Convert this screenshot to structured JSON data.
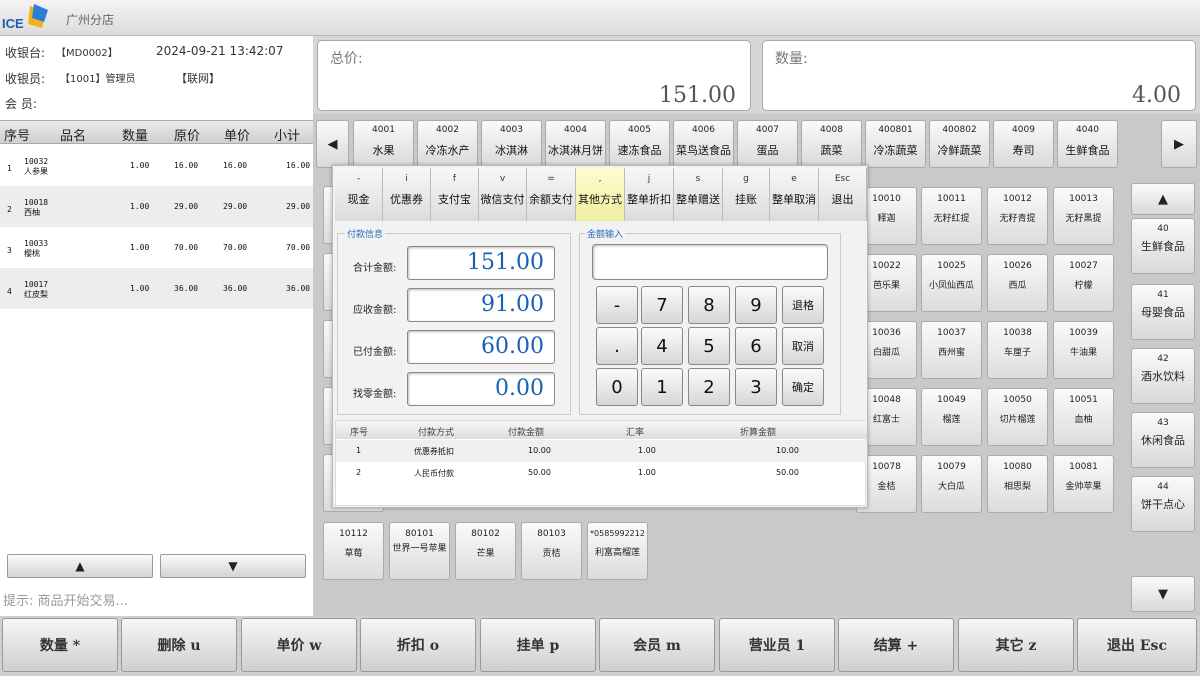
{
  "app": {
    "logo_text": "ICE",
    "branch": "广州分店"
  },
  "cashier": {
    "register_label": "收银台:",
    "register_value": "【MD0002】",
    "datetime": "2024-09-21 13:42:07",
    "operator_label": "收银员:",
    "operator_value": "【1001】管理员",
    "network": "【联网】",
    "member_label": "会  员:"
  },
  "item_table": {
    "headers": [
      "序号",
      "品名",
      "数量",
      "原价",
      "单价",
      "小计"
    ],
    "rows": [
      {
        "no": "1",
        "code": "10032",
        "name": "人参果",
        "qty": "1.00",
        "orig": "16.00",
        "price": "16.00",
        "sub": "16.00"
      },
      {
        "no": "2",
        "code": "10018",
        "name": "西柚",
        "qty": "1.00",
        "orig": "29.00",
        "price": "29.00",
        "sub": "29.00"
      },
      {
        "no": "3",
        "code": "10033",
        "name": "樱桃",
        "qty": "1.00",
        "orig": "70.00",
        "price": "70.00",
        "sub": "70.00"
      },
      {
        "no": "4",
        "code": "10017",
        "name": "红皮梨",
        "qty": "1.00",
        "orig": "36.00",
        "price": "36.00",
        "sub": "36.00"
      }
    ]
  },
  "scroll": {
    "up": "▲",
    "down": "▼"
  },
  "hint": "提示: 商品开始交易...",
  "totals": {
    "total_label": "总价:",
    "total_value": "151.00",
    "qty_label": "数量:",
    "qty_value": "4.00"
  },
  "categories": [
    {
      "code": "4001",
      "name": "水果"
    },
    {
      "code": "4002",
      "name": "冷冻水产"
    },
    {
      "code": "4003",
      "name": "冰淇淋"
    },
    {
      "code": "4004",
      "name": "冰淇淋月饼"
    },
    {
      "code": "4005",
      "name": "速冻食品"
    },
    {
      "code": "4006",
      "name": "菜鸟送食品"
    },
    {
      "code": "4007",
      "name": "蛋品"
    },
    {
      "code": "4008",
      "name": "蔬菜"
    },
    {
      "code": "400801",
      "name": "冷冻蔬菜"
    },
    {
      "code": "400802",
      "name": "冷鲜蔬菜"
    },
    {
      "code": "4009",
      "name": "寿司"
    },
    {
      "code": "4040",
      "name": "生鲜食品"
    }
  ],
  "nav": {
    "prev": "◀",
    "next": "▶",
    "up": "▲",
    "down": "▼"
  },
  "side_categories": [
    {
      "code": "40",
      "name": "生鲜食品"
    },
    {
      "code": "41",
      "name": "母婴食品"
    },
    {
      "code": "42",
      "name": "酒水饮料"
    },
    {
      "code": "43",
      "name": "休闲食品"
    },
    {
      "code": "44",
      "name": "饼干点心"
    }
  ],
  "products_right": [
    [
      {
        "code": "10010",
        "name": "释迦"
      },
      {
        "code": "10011",
        "name": "无籽红提"
      },
      {
        "code": "10012",
        "name": "无籽青提"
      },
      {
        "code": "10013",
        "name": "无籽黑提"
      }
    ],
    [
      {
        "code": "10022",
        "name": "芭乐果"
      },
      {
        "code": "10025",
        "name": "小凤仙西瓜"
      },
      {
        "code": "10026",
        "name": "西瓜"
      },
      {
        "code": "10027",
        "name": "柠檬"
      }
    ],
    [
      {
        "code": "10036",
        "name": "白甜瓜"
      },
      {
        "code": "10037",
        "name": "西州蜜"
      },
      {
        "code": "10038",
        "name": "车厘子"
      },
      {
        "code": "10039",
        "name": "牛油果"
      }
    ],
    [
      {
        "code": "10048",
        "name": "红富士"
      },
      {
        "code": "10049",
        "name": "榴莲"
      },
      {
        "code": "10050",
        "name": "切片榴莲"
      },
      {
        "code": "10051",
        "name": "血柚"
      }
    ],
    [
      {
        "code": "10078",
        "name": "金桔"
      },
      {
        "code": "10079",
        "name": "大白瓜"
      },
      {
        "code": "10080",
        "name": "相思梨"
      },
      {
        "code": "10081",
        "name": "金帅苹果"
      }
    ]
  ],
  "products_bottom": [
    {
      "code": "10112",
      "name": "草莓"
    },
    {
      "code": "80101",
      "name": "世界一号苹果"
    },
    {
      "code": "80102",
      "name": "芒果"
    },
    {
      "code": "80103",
      "name": "贡桔"
    },
    {
      "code": "*0585992212",
      "name": "利富高榴莲"
    }
  ],
  "dialog": {
    "pay_methods": [
      {
        "key": "-",
        "label": "现金"
      },
      {
        "key": "i",
        "label": "优惠券"
      },
      {
        "key": "f",
        "label": "支付宝"
      },
      {
        "key": "v",
        "label": "微信支付"
      },
      {
        "key": "=",
        "label": "余额支付"
      },
      {
        "key": ",",
        "label": "其他方式"
      },
      {
        "key": "j",
        "label": "整单折扣"
      },
      {
        "key": "s",
        "label": "整单赠送"
      },
      {
        "key": "g",
        "label": "挂账"
      },
      {
        "key": "e",
        "label": "整单取消"
      },
      {
        "key": "Esc",
        "label": "退出"
      }
    ],
    "payinfo_title": "付款信息",
    "amounts": [
      {
        "label": "合计金额:",
        "value": "151.00"
      },
      {
        "label": "应收金额:",
        "value": "91.00"
      },
      {
        "label": "已付金额:",
        "value": "60.00"
      },
      {
        "label": "找零金额:",
        "value": "0.00"
      }
    ],
    "input_title": "金额输入",
    "input_value": "",
    "keys": {
      "minus": "-",
      "k7": "7",
      "k8": "8",
      "k9": "9",
      "back": "退格",
      "dot": ".",
      "k4": "4",
      "k5": "5",
      "k6": "6",
      "cancel": "取消",
      "k0": "0",
      "k1": "1",
      "k2": "2",
      "k3": "3",
      "ok": "确定"
    },
    "pay_table": {
      "headers": [
        "序号",
        "付款方式",
        "付款金额",
        "汇率",
        "折算金额"
      ],
      "rows": [
        {
          "no": "1",
          "method": "优惠券抵扣",
          "amount": "10.00",
          "rate": "1.00",
          "converted": "10.00"
        },
        {
          "no": "2",
          "method": "人民币付款",
          "amount": "50.00",
          "rate": "1.00",
          "converted": "50.00"
        }
      ]
    }
  },
  "function_keys": [
    "数量 *",
    "删除 u",
    "单价 w",
    "折扣 o",
    "挂单 p",
    "会员 m",
    "营业员 1",
    "结算 +",
    "其它 z",
    "退出 Esc"
  ],
  "colors": {
    "accent": "#1a5fb4",
    "active_tab": "#eef0a0"
  }
}
